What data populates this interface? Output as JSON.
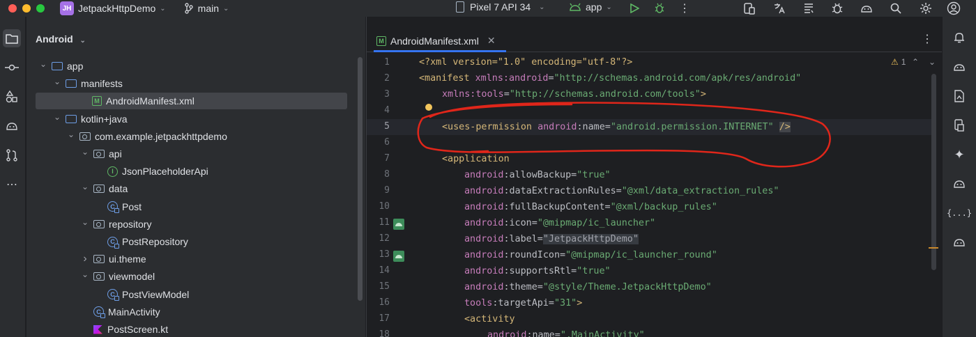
{
  "titlebar": {
    "project_badge": "JH",
    "project_name": "JetpackHttpDemo",
    "branch": "main",
    "device": "Pixel 7 API 34",
    "run_config": "app"
  },
  "project_panel": {
    "view_label": "Android",
    "tree": [
      {
        "label": "app",
        "depth": 0,
        "expanded": true,
        "icon": "module-folder-icon"
      },
      {
        "label": "manifests",
        "depth": 1,
        "expanded": true,
        "icon": "folder-icon"
      },
      {
        "label": "AndroidManifest.xml",
        "depth": 2,
        "icon": "manifest-file-icon",
        "selected": true
      },
      {
        "label": "kotlin+java",
        "depth": 1,
        "expanded": true,
        "icon": "folder-icon"
      },
      {
        "label": "com.example.jetpackhttpdemo",
        "depth": 2,
        "expanded": true,
        "icon": "package-icon"
      },
      {
        "label": "api",
        "depth": 3,
        "expanded": true,
        "icon": "package-icon"
      },
      {
        "label": "JsonPlaceholderApi",
        "depth": 4,
        "icon": "interface-icon"
      },
      {
        "label": "data",
        "depth": 3,
        "expanded": true,
        "icon": "package-icon"
      },
      {
        "label": "Post",
        "depth": 4,
        "icon": "class-icon"
      },
      {
        "label": "repository",
        "depth": 3,
        "expanded": true,
        "icon": "package-icon"
      },
      {
        "label": "PostRepository",
        "depth": 4,
        "icon": "class-icon"
      },
      {
        "label": "ui.theme",
        "depth": 3,
        "expanded": false,
        "icon": "package-icon"
      },
      {
        "label": "viewmodel",
        "depth": 3,
        "expanded": true,
        "icon": "package-icon"
      },
      {
        "label": "PostViewModel",
        "depth": 4,
        "icon": "class-icon"
      },
      {
        "label": "MainActivity",
        "depth": 3,
        "icon": "class-icon"
      },
      {
        "label": "PostScreen.kt",
        "depth": 3,
        "icon": "kotlin-file-icon"
      }
    ]
  },
  "editor": {
    "tab_label": "AndroidManifest.xml",
    "tab_icon_letter": "M",
    "warning_count": "1",
    "line_numbers": [
      "1",
      "2",
      "3",
      "4",
      "5",
      "6",
      "7",
      "8",
      "9",
      "10",
      "11",
      "12",
      "13",
      "14",
      "15",
      "16",
      "17",
      "18"
    ],
    "current_line": "5",
    "code": {
      "l1": "<?xml version=\"1.0\" encoding=\"utf-8\"?>",
      "l2_tag": "<manifest ",
      "l2_ns": "xmlns:android",
      "l2_eq": "=",
      "l2_val": "\"http://schemas.android.com/apk/res/android\"",
      "l3_ns": "xmlns:tools",
      "l3_val": "\"http://schemas.android.com/tools\"",
      "l3_close": ">",
      "l5_tag": "<uses-permission ",
      "l5_ns": "android",
      "l5_attr": ":name=",
      "l5_val": "\"android.permission.INTERNET\"",
      "l5_close": "/>",
      "l7_tag": "<application",
      "attrs": [
        {
          "ns": "android",
          "name": ":allowBackup=",
          "val": "\"true\""
        },
        {
          "ns": "android",
          "name": ":dataExtractionRules=",
          "val": "\"@xml/data_extraction_rules\""
        },
        {
          "ns": "android",
          "name": ":fullBackupContent=",
          "val": "\"@xml/backup_rules\""
        },
        {
          "ns": "android",
          "name": ":icon=",
          "val": "\"@mipmap/ic_launcher\""
        },
        {
          "ns": "android",
          "name": ":label=",
          "val": "\"JetpackHttpDemo\""
        },
        {
          "ns": "android",
          "name": ":roundIcon=",
          "val": "\"@mipmap/ic_launcher_round\""
        },
        {
          "ns": "android",
          "name": ":supportsRtl=",
          "val": "\"true\""
        },
        {
          "ns": "android",
          "name": ":theme=",
          "val": "\"@style/Theme.JetpackHttpDemo\""
        },
        {
          "ns": "tools",
          "name": ":targetApi=",
          "val": "\"31\"",
          "close": ">"
        }
      ],
      "l17_tag": "<activity",
      "l18_ns": "android",
      "l18_name": ":name=",
      "l18_val": "\".MainActivity\""
    }
  },
  "colors": {
    "accent": "#3574f0",
    "xml_tag": "#d5b778",
    "xml_namespace": "#c77dbb",
    "xml_string": "#6aab73",
    "annotation_red": "#e0261a"
  }
}
